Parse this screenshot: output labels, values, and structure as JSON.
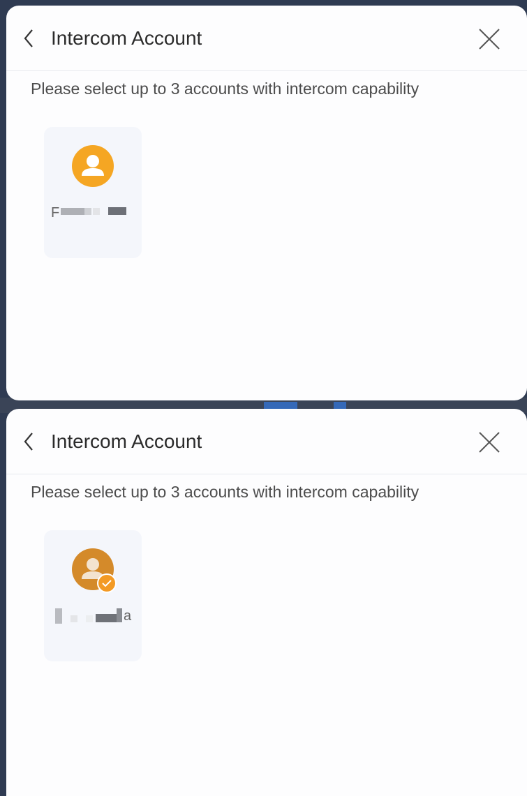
{
  "screens": [
    {
      "title": "Intercom Account",
      "subtitle": "Please select up to 3 accounts with intercom capability",
      "account": {
        "name_visible": "F",
        "selected": false
      }
    },
    {
      "title": "Intercom Account",
      "subtitle": "Please select up to 3 accounts with intercom capability",
      "account": {
        "name_visible": "a",
        "selected": true
      }
    }
  ],
  "colors": {
    "accent_orange": "#f5a623",
    "avatar_selected": "#d48a2a",
    "card_bg": "#f4f6fb"
  }
}
